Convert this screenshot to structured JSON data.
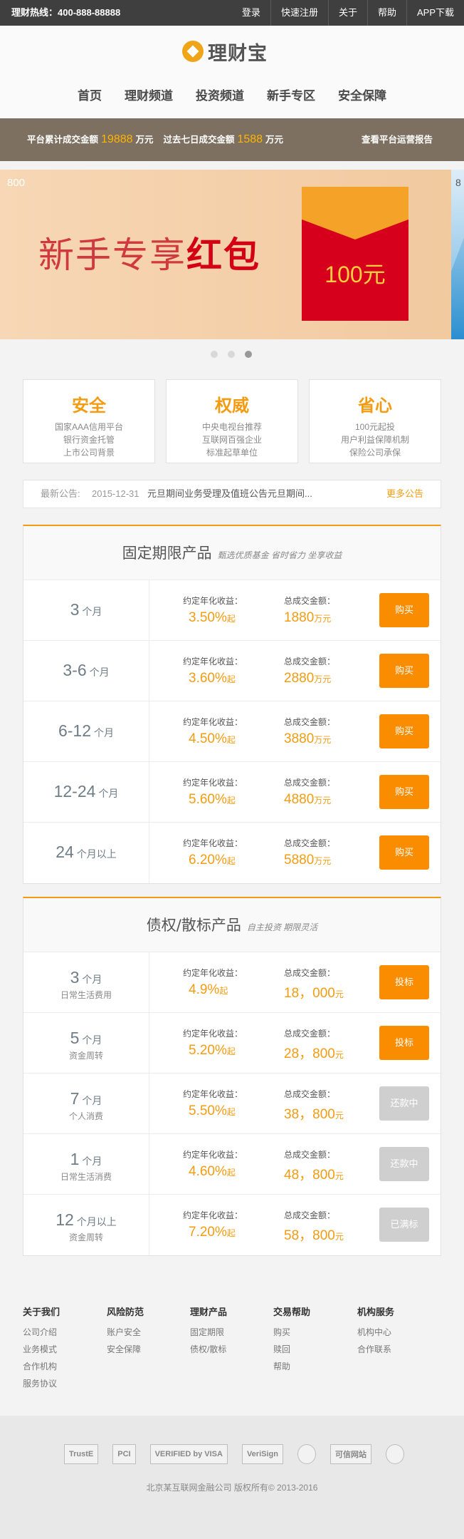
{
  "topbar": {
    "hotline": "理财热线：400-888-88888",
    "links": [
      "登录",
      "快速注册",
      "关于",
      "帮助",
      "APP下载"
    ]
  },
  "brand": {
    "name": "理财宝"
  },
  "nav": [
    "首页",
    "理财频道",
    "投资频道",
    "新手专区",
    "安全保障"
  ],
  "stats": {
    "label_total": "平台累计成交金额",
    "total": "19888",
    "unit1": "万元",
    "label_week": "过去七日成交金额",
    "week": "1588",
    "unit2": "万元",
    "report_link": "查看平台运营报告"
  },
  "banner": {
    "corner": "800",
    "headline_plain": "新手专享",
    "headline_bold": "红包",
    "envelope_amount": "100元",
    "next_corner": "8",
    "slide_count": 3,
    "active_slide": 3
  },
  "features": [
    {
      "title": "安全",
      "lines": [
        "国家AAA信用平台",
        "银行资金托管",
        "上市公司背景"
      ]
    },
    {
      "title": "权威",
      "lines": [
        "中央电视台推荐",
        "互联网百强企业",
        "标准起草单位"
      ]
    },
    {
      "title": "省心",
      "lines": [
        "100元起投",
        "用户利益保障机制",
        "保险公司承保"
      ]
    }
  ],
  "notice": {
    "label": "最新公告:",
    "date": "2015-12-31",
    "text": "元旦期间业务受理及值班公告元旦期间...",
    "more": "更多公告"
  },
  "fixed_panel": {
    "title": "固定期限产品",
    "subtitle": "甄选优质基金  省时省力  坐享收益",
    "rate_caption": "约定年化收益：",
    "amount_caption": "总成交金额：",
    "rows": [
      {
        "term": "3",
        "unit": "个月",
        "rate": "3.50%",
        "rate_suffix": "起",
        "amount": "1880",
        "amount_unit": "万元",
        "button": "购买"
      },
      {
        "term": "3-6",
        "unit": "个月",
        "rate": "3.60%",
        "rate_suffix": "起",
        "amount": "2880",
        "amount_unit": "万元",
        "button": "购买"
      },
      {
        "term": "6-12",
        "unit": "个月",
        "rate": "4.50%",
        "rate_suffix": "起",
        "amount": "3880",
        "amount_unit": "万元",
        "button": "购买"
      },
      {
        "term": "12-24",
        "unit": "个月",
        "rate": "5.60%",
        "rate_suffix": "起",
        "amount": "4880",
        "amount_unit": "万元",
        "button": "购买"
      },
      {
        "term": "24",
        "unit": "个月以上",
        "rate": "6.20%",
        "rate_suffix": "起",
        "amount": "5880",
        "amount_unit": "万元",
        "button": "购买"
      }
    ]
  },
  "debt_panel": {
    "title": "债权/散标产品",
    "subtitle": "自主投资  期限灵活",
    "rate_caption": "约定年化收益：",
    "amount_caption": "总成交金额：",
    "rows": [
      {
        "term": "3",
        "unit": "个月",
        "purpose": "日常生活费用",
        "rate": "4.9%",
        "rate_suffix": "起",
        "amount": "18，000",
        "amount_unit": "元",
        "button": "投标",
        "active": true
      },
      {
        "term": "5",
        "unit": "个月",
        "purpose": "资金周转",
        "rate": "5.20%",
        "rate_suffix": "起",
        "amount": "28，800",
        "amount_unit": "元",
        "button": "投标",
        "active": true
      },
      {
        "term": "7",
        "unit": "个月",
        "purpose": "个人消费",
        "rate": "5.50%",
        "rate_suffix": "起",
        "amount": "38，800",
        "amount_unit": "元",
        "button": "还款中",
        "active": false
      },
      {
        "term": "1",
        "unit": "个月",
        "purpose": "日常生活消费",
        "rate": "4.60%",
        "rate_suffix": "起",
        "amount": "48，800",
        "amount_unit": "元",
        "button": "还款中",
        "active": false
      },
      {
        "term": "12",
        "unit": "个月以上",
        "purpose": "资金周转",
        "rate": "7.20%",
        "rate_suffix": "起",
        "amount": "58，800",
        "amount_unit": "元",
        "button": "已满标",
        "active": false
      }
    ]
  },
  "footer": {
    "columns": [
      {
        "heading": "关于我们",
        "links": [
          "公司介绍",
          "业务模式",
          "合作机构",
          "服务协议"
        ]
      },
      {
        "heading": "风险防范",
        "links": [
          "账户安全",
          "安全保障"
        ]
      },
      {
        "heading": "理财产品",
        "links": [
          "固定期限",
          "债权/散标"
        ]
      },
      {
        "heading": "交易帮助",
        "links": [
          "购买",
          "赎回",
          "帮助"
        ]
      },
      {
        "heading": "机构服务",
        "links": [
          "机构中心",
          "合作联系"
        ]
      }
    ],
    "certs": [
      "TrustE",
      "PCI",
      "VERIFIED by VISA",
      "VeriSign",
      "",
      "可信网站",
      ""
    ],
    "copyright": "北京某互联网金融公司 版权所有© 2013-2016"
  }
}
